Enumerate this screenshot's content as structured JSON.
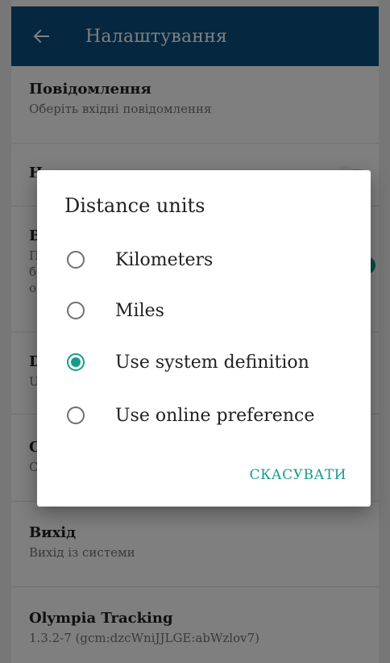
{
  "appbar": {
    "title": "Налаштування",
    "back_icon": "arrow-back-icon"
  },
  "settings": [
    {
      "primary": "Повідомлення",
      "secondary": "Оберіть вхідні повідомлення"
    },
    {
      "primary": "Н",
      "secondary": ""
    },
    {
      "primary": "В",
      "secondary": "П\nб\nо"
    },
    {
      "primary": "D",
      "secondary": "U"
    },
    {
      "primary": "С",
      "secondary": "С"
    },
    {
      "primary": "Вихід",
      "secondary": "Вихід із системи"
    },
    {
      "primary": "Olympia Tracking",
      "secondary": "1.3.2-7 (gcm:dzcWniJJLGE:abWzlov7)"
    }
  ],
  "dialog": {
    "title": "Distance units",
    "options": [
      {
        "label": "Kilometers",
        "checked": false
      },
      {
        "label": "Miles",
        "checked": false
      },
      {
        "label": "Use system definition",
        "checked": true
      },
      {
        "label": "Use online preference",
        "checked": false
      }
    ],
    "cancel_label": "СКАСУВАТИ"
  },
  "colors": {
    "appbar": "#0b4f7f",
    "accent": "#179c8b",
    "toggle_on": "#179c8b",
    "toggle_off": "#bdbdbd"
  }
}
